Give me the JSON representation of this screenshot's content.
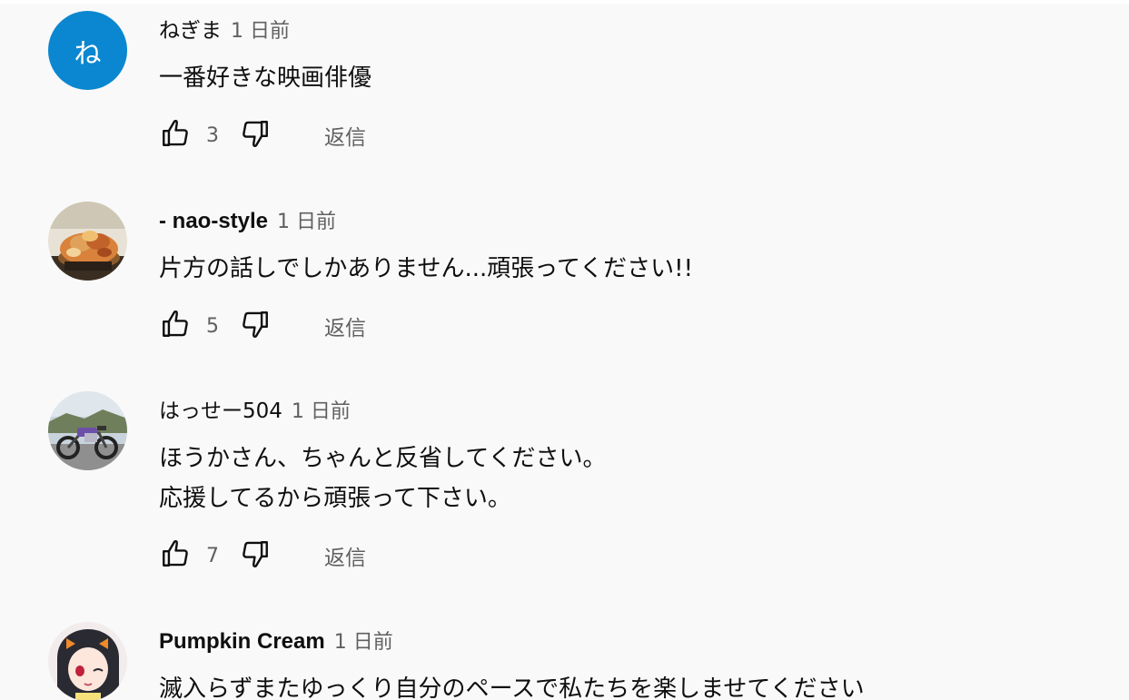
{
  "comments": [
    {
      "author": "ねぎま",
      "time": "1 日前",
      "avatar_letter": "ね",
      "avatar_color": "#0a87d0",
      "lines": [
        "一番好きな映画俳優"
      ],
      "likes": "3",
      "reply_label": "返信"
    },
    {
      "author": "- nao-style",
      "time": "1 日前",
      "avatar_icon": "food-photo-avatar",
      "lines": [
        "片方の話しでしかありません...頑張ってください!!"
      ],
      "likes": "5",
      "reply_label": "返信"
    },
    {
      "author": "はっせー504",
      "time": "1 日前",
      "avatar_icon": "motorcycle-photo-avatar",
      "lines": [
        "ほうかさん、ちゃんと反省してください。",
        "応援してるから頑張って下さい。"
      ],
      "likes": "7",
      "reply_label": "返信"
    },
    {
      "author": "Pumpkin Cream",
      "time": "1 日前",
      "avatar_icon": "anime-character-avatar",
      "lines": [
        "滅入らずまたゆっくり自分のペースで私たちを楽しませてください"
      ],
      "likes": "",
      "reply_label": ""
    }
  ],
  "icons": {
    "like": "thumb-up-icon",
    "dislike": "thumb-down-icon"
  },
  "colors": {
    "background": "#f9f9f9",
    "primary_text": "#0f0f0f",
    "secondary_text": "#606060"
  }
}
